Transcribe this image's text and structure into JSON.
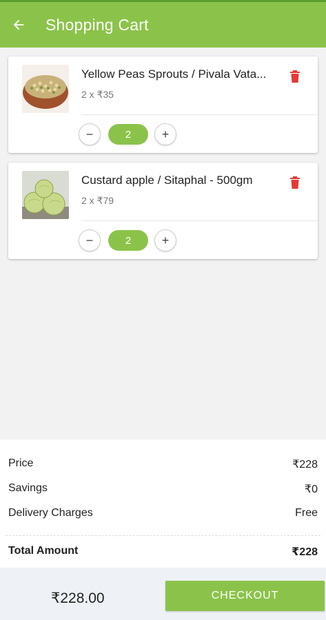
{
  "header": {
    "title": "Shopping Cart",
    "back_icon": "arrow-left-icon"
  },
  "colors": {
    "primary": "#8bc34a",
    "delete": "#e53935"
  },
  "cart": {
    "items": [
      {
        "name": "Yellow Peas Sprouts / Pivala Vata...",
        "qty_price": "2 x ₹35",
        "quantity": "2",
        "minus": "−",
        "plus": "+"
      },
      {
        "name": "Custard apple / Sitaphal - 500gm",
        "qty_price": "2 x ₹79",
        "quantity": "2",
        "minus": "−",
        "plus": "+"
      }
    ]
  },
  "summary": {
    "price_label": "Price",
    "price_value": "₹228",
    "savings_label": "Savings",
    "savings_value": "₹0",
    "delivery_label": "Delivery Charges",
    "delivery_value": "Free",
    "total_label": "Total Amount",
    "total_value": "₹228"
  },
  "footer": {
    "grand_total": "₹228.00",
    "checkout_label": "CHECKOUT"
  }
}
